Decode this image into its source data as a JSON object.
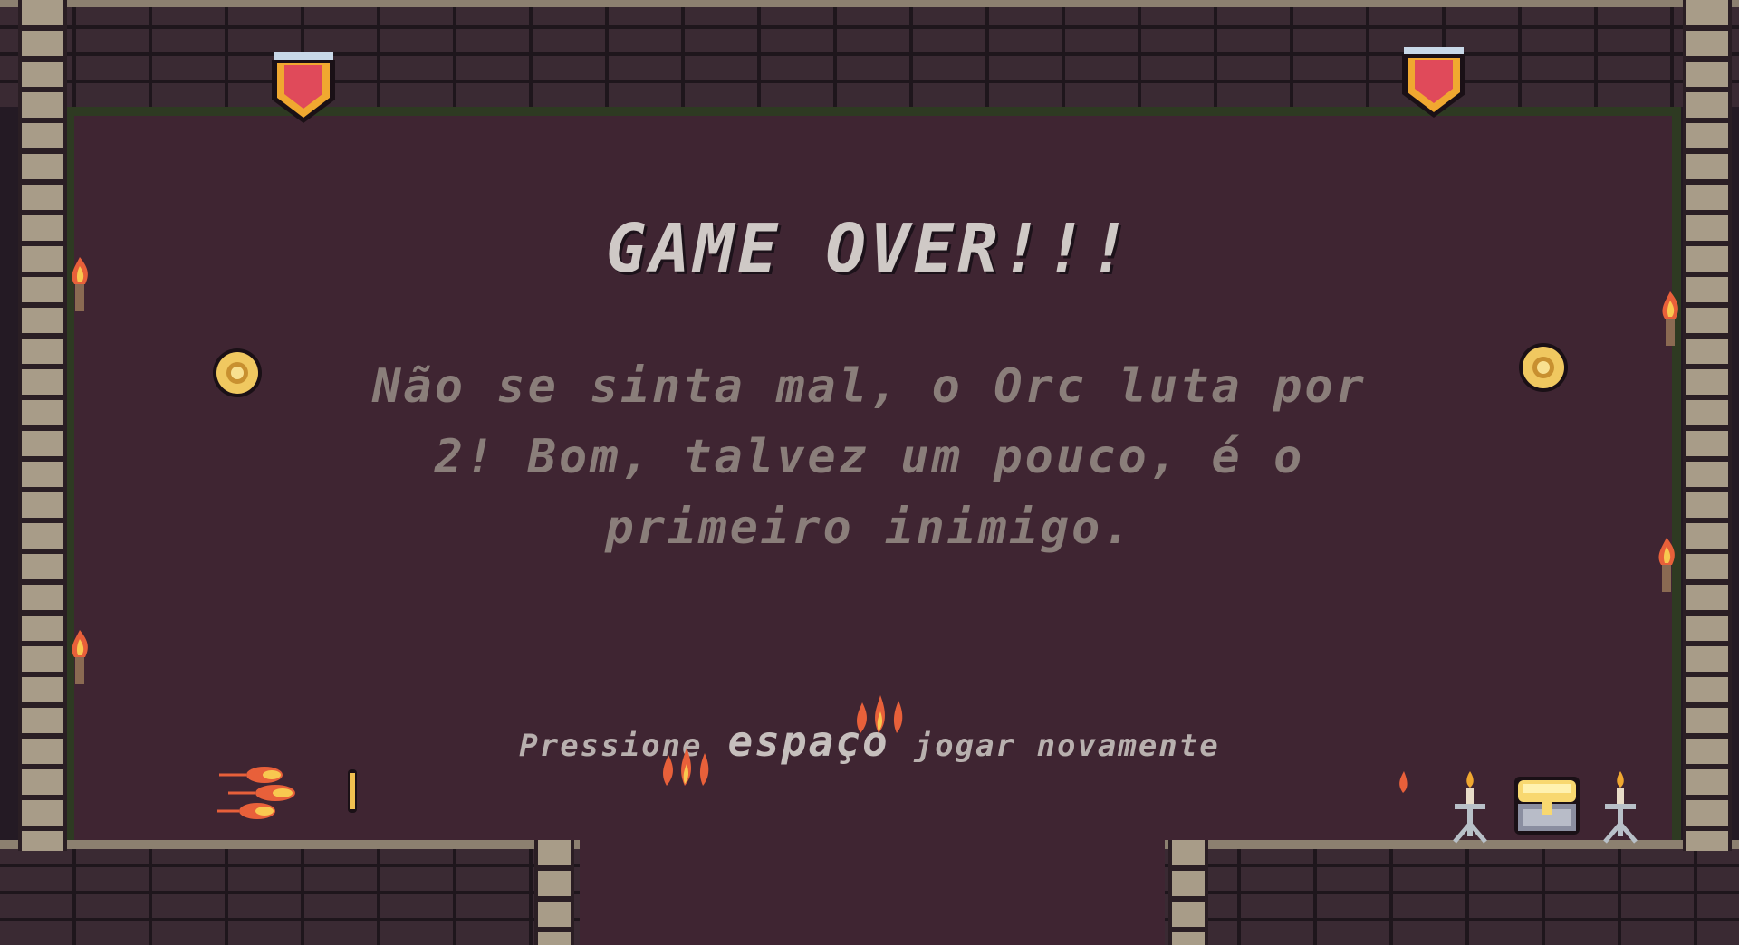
{
  "screen": "game-over",
  "title": "GAME OVER!!!",
  "message_lines": [
    "Não se sinta mal, o Orc luta por",
    "2! Bom, talvez um pouco, é o",
    "primeiro inimigo."
  ],
  "prompt": {
    "before": "Pressione",
    "key": "espaço",
    "after": "jogar novamente"
  },
  "colors": {
    "floor": "#3f2532",
    "wall": "#3a2a33",
    "title": "#cfc9c6",
    "message": "#8a7e7a",
    "banner_red": "#e04a5a",
    "banner_gold": "#f0a830",
    "coin": "#f0c860"
  },
  "icons": [
    "banner-icon",
    "torch-icon",
    "coin-icon",
    "fireball-icon",
    "flame-icon",
    "candle-stand-icon",
    "treasure-chest-icon"
  ]
}
